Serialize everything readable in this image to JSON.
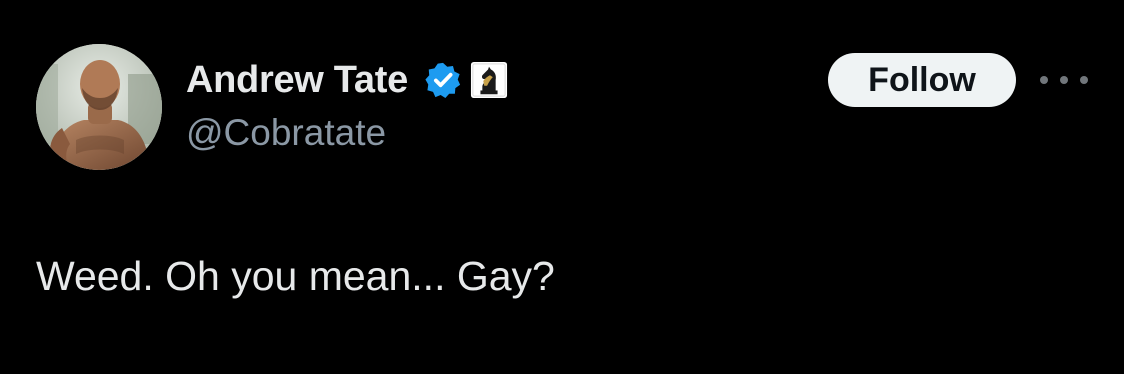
{
  "author": {
    "display_name": "Andrew Tate",
    "handle": "@Cobratate",
    "avatar_icon": "profile-photo",
    "verified_icon": "verified-checkmark-icon",
    "verified_color": "#1d9bf0",
    "affiliate_icon": "chess-knight-badge-icon"
  },
  "actions": {
    "follow_label": "Follow",
    "more_icon": "more-horizontal-icon"
  },
  "tweet": {
    "text": "Weed. Oh you mean... Gay?"
  },
  "colors": {
    "background": "#000000",
    "primary_text": "#e7e9ea",
    "secondary_text": "#8b98a5",
    "follow_button_bg": "#eff3f4",
    "follow_button_text": "#0f1419"
  }
}
